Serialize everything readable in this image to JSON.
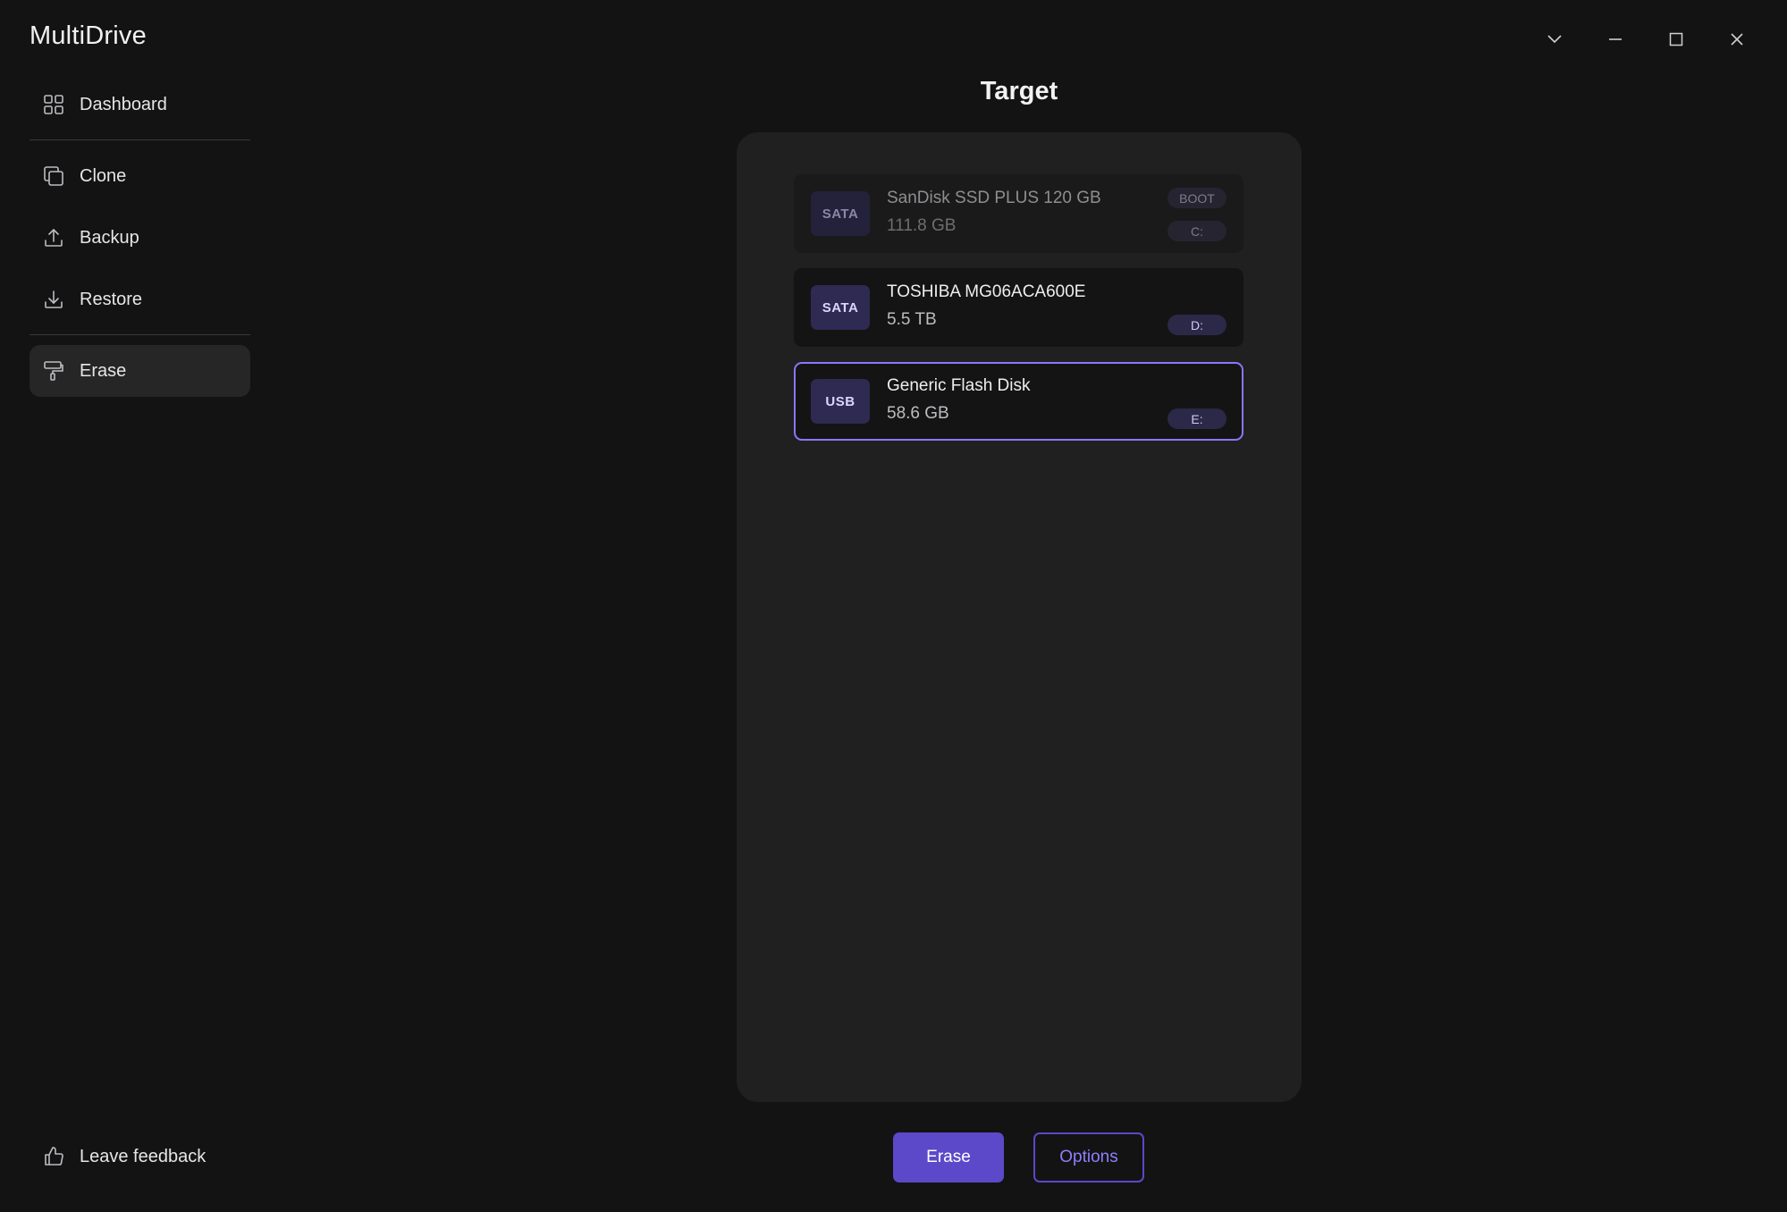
{
  "app": {
    "title": "MultiDrive"
  },
  "window_controls": {
    "dropdown_icon": "chevron-down-icon",
    "minimize_icon": "minimize-icon",
    "maximize_icon": "maximize-icon",
    "close_icon": "close-icon"
  },
  "sidebar": {
    "items": [
      {
        "label": "Dashboard",
        "icon": "grid-icon"
      },
      {
        "label": "Clone",
        "icon": "copy-icon"
      },
      {
        "label": "Backup",
        "icon": "upload-icon"
      },
      {
        "label": "Restore",
        "icon": "download-icon"
      },
      {
        "label": "Erase",
        "icon": "paint-roller-icon",
        "active": true
      }
    ],
    "feedback_label": "Leave feedback"
  },
  "main": {
    "title": "Target",
    "disks": [
      {
        "bus": "SATA",
        "name": "SanDisk SSD PLUS 120 GB",
        "size": "111.8 GB",
        "boot_badge": "BOOT",
        "letter": "C:",
        "state": "disabled"
      },
      {
        "bus": "SATA",
        "name": "TOSHIBA MG06ACA600E",
        "size": "5.5 TB",
        "letter": "D:",
        "state": "normal"
      },
      {
        "bus": "USB",
        "name": "Generic Flash Disk",
        "size": "58.6 GB",
        "letter": "E:",
        "state": "selected"
      }
    ]
  },
  "actions": {
    "erase_label": "Erase",
    "options_label": "Options"
  },
  "colors": {
    "accent": "#5b49c9",
    "selection_border": "#8c76ff",
    "background": "#131313",
    "panel": "#202020"
  }
}
